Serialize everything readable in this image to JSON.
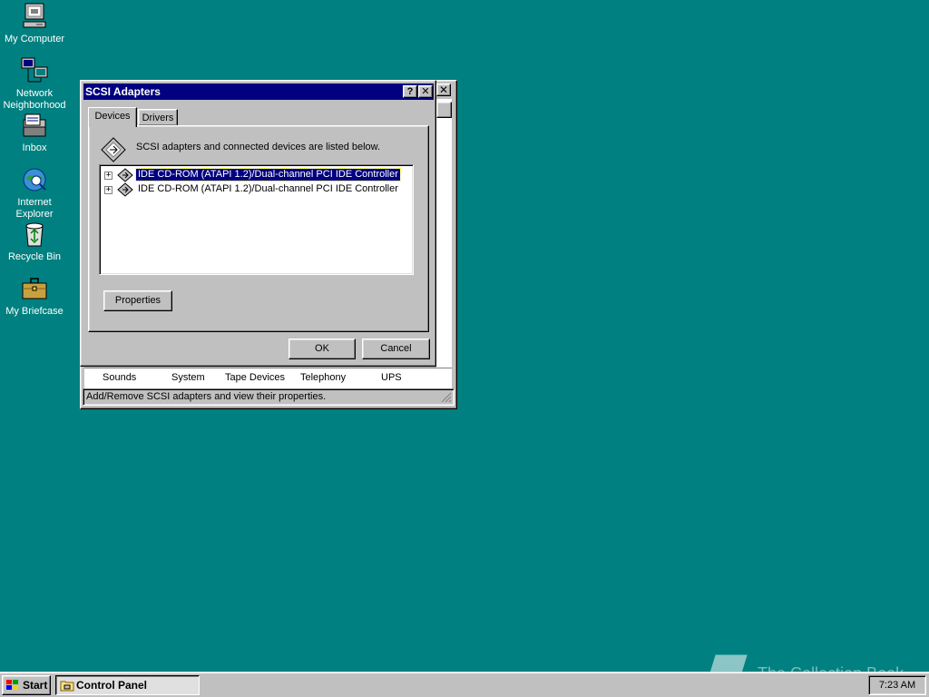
{
  "desktop": {
    "icons": [
      {
        "label": "My Computer",
        "icon": "my-computer-icon"
      },
      {
        "label": "Network Neighborhood",
        "icon": "network-neighborhood-icon"
      },
      {
        "label": "Inbox",
        "icon": "inbox-icon"
      },
      {
        "label": "Internet Explorer",
        "icon": "internet-explorer-icon"
      },
      {
        "label": "Recycle Bin",
        "icon": "recycle-bin-icon"
      },
      {
        "label": "My Briefcase",
        "icon": "briefcase-icon"
      }
    ],
    "background_color": "#008080"
  },
  "control_panel": {
    "items": [
      "Sounds",
      "System",
      "Tape Devices",
      "Telephony",
      "UPS"
    ],
    "status_text": "Add/Remove SCSI adapters and view their properties."
  },
  "dialog": {
    "title": "SCSI Adapters",
    "help_button": "?",
    "close_button": "✕",
    "tabs": [
      {
        "label": "Devices",
        "active": true
      },
      {
        "label": "Drivers",
        "active": false
      }
    ],
    "description": "SCSI adapters and connected devices are listed below.",
    "devices": [
      {
        "label": "IDE CD-ROM (ATAPI 1.2)/Dual-channel PCI IDE Controller",
        "selected": true,
        "expander": "+"
      },
      {
        "label": "IDE CD-ROM (ATAPI 1.2)/Dual-channel PCI IDE Controller",
        "selected": false,
        "expander": "+"
      }
    ],
    "properties_button": "Properties",
    "ok_button": "OK",
    "cancel_button": "Cancel"
  },
  "taskbar": {
    "start_label": "Start",
    "tasks": [
      {
        "label": "Control Panel"
      }
    ],
    "clock": "7:23 AM"
  },
  "watermark": {
    "text": "The Collection Book"
  },
  "colors": {
    "title_bar": "#000080",
    "face": "#c0c0c0",
    "selection": "#000080"
  }
}
